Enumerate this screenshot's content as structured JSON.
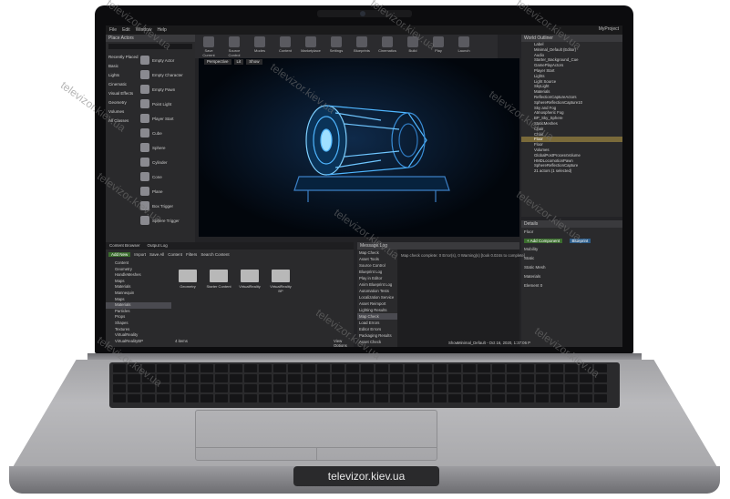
{
  "watermark": {
    "main": "televizor.kiev.ua",
    "repeat": [
      "televizor.kiev.ua",
      "televizor.kiev.ua",
      "televizor.kiev.ua",
      "televizor.kiev.ua",
      "televizor.kiev.ua",
      "televizor.kiev.ua",
      "televizor.kiev.ua",
      "televizor.kiev.ua",
      "televizor.kiev.ua",
      "televizor.kiev.ua",
      "televizor.kiev.ua",
      "televizor.kiev.ua"
    ]
  },
  "editor": {
    "menu": [
      "File",
      "Edit",
      "Window",
      "Help"
    ],
    "project": "MyProject",
    "toolbar": [
      "Save Current",
      "Source Control",
      "Modes",
      "Content",
      "Marketplace",
      "Settings",
      "Blueprints",
      "Cinematics",
      "Build",
      "Play",
      "Launch"
    ],
    "place_actors": {
      "title": "Place Actors",
      "search_placeholder": "Search Classes",
      "categories": [
        "Recently Placed",
        "Basic",
        "Lights",
        "Cinematic",
        "Visual Effects",
        "Geometry",
        "Volumes",
        "All Classes"
      ],
      "actors": [
        "Empty Actor",
        "Empty Character",
        "Empty Pawn",
        "Point Light",
        "Player Start",
        "Cube",
        "Sphere",
        "Cylinder",
        "Cone",
        "Plane",
        "Box Trigger",
        "Sphere Trigger"
      ]
    },
    "viewport": {
      "perspective": "Perspective",
      "lit": "Lit",
      "show": "Show"
    },
    "outliner": {
      "title": "World Outliner",
      "label_col": "Label",
      "items": [
        "Minimal_Default (Editor)",
        "Audio",
        "Starter_Background_Cue",
        "GamePlayActors",
        "Player Start",
        "Lights",
        "Light Source",
        "SkyLight",
        "Materials",
        "ReflectionCaptureActors",
        "SphereReflectionCapture10",
        "Sky and Fog",
        "Atmospheric Fog",
        "BP_Sky_Sphere",
        "StaticMeshes",
        "Chair",
        "Chair",
        "Floor",
        "Floor",
        "Volumes",
        "GlobalPostProcessVolume",
        "HMDLocomotionPawn",
        "SphereReflectionCapture"
      ],
      "selected_index": 17,
      "status": "21 actors (1 selected)"
    },
    "details": {
      "title": "Details",
      "name": "Floor",
      "add_component": "+ Add Component",
      "blueprint": "Blueprint",
      "mobility": "Mobility",
      "static": "Static",
      "static_mesh": "Static Mesh",
      "materials": "Materials",
      "element": "Element 0"
    },
    "content_browser": {
      "tabs": [
        "Content Browser",
        "Output Log"
      ],
      "add_new": "Add New",
      "import": "Import",
      "save_all": "Save All",
      "path": "Content",
      "filters": "Filters",
      "search_placeholder": "Search Content",
      "tree": [
        "Content",
        "Geometry",
        "HandleMeshes",
        "Maps",
        "Materials",
        "Mannequin",
        "Maps",
        "Materials",
        "Particles",
        "Props",
        "Shapes",
        "Textures",
        "VirtualReality",
        "VirtualRealityBP"
      ],
      "selected_tree_index": 7,
      "folders": [
        "Geometry",
        "Starter Content",
        "VirtualReality",
        "VirtualReality BP"
      ],
      "items_count": "4 items",
      "view_options": "View Options"
    },
    "message_log": {
      "title": "Message Log",
      "sources": [
        "Map Check",
        "Asset Tools",
        "Source Control",
        "Blueprint Log",
        "Play in Editor",
        "Anim Blueprint Log",
        "Automation Tests",
        "Localization Service",
        "Asset Reimport",
        "Lighting Results",
        "Map Check",
        "Load Errors",
        "Editor Errors",
        "Packaging Results",
        "Asset Check"
      ],
      "selected_index": 10,
      "text": "Map check complete: 0 Error(s), 0 Warning(s) [took 0.024s to complete]",
      "show": "Show",
      "timestamp": "Minimal_Default - Oct 16, 2020, 1:37:06 P"
    }
  }
}
